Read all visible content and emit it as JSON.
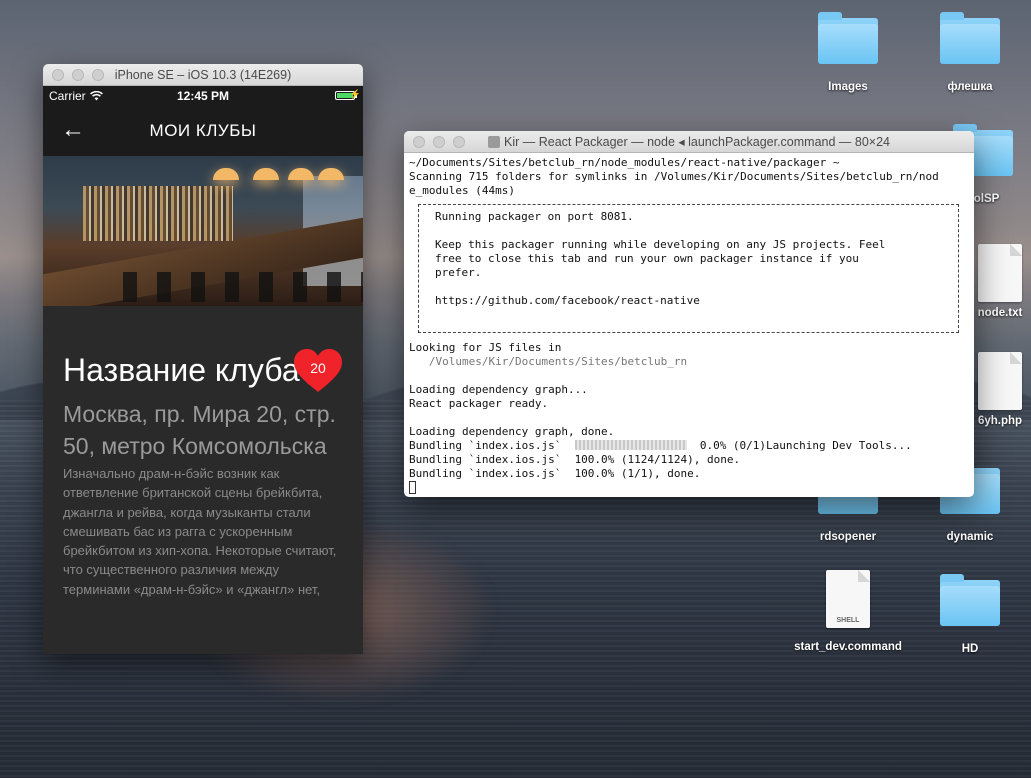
{
  "desktop": {
    "icons": [
      {
        "label": "Images",
        "kind": "folder"
      },
      {
        "label": "флешка",
        "kind": "folder"
      },
      {
        "label": "nolSP",
        "kind": "folder"
      },
      {
        "label": "node.txt",
        "kind": "file"
      },
      {
        "label": "6yh.php",
        "kind": "file"
      },
      {
        "label": "rdsopener",
        "kind": "folder"
      },
      {
        "label": "dynamic",
        "kind": "folder"
      },
      {
        "label": "start_dev.command",
        "kind": "shell",
        "badge": "SHELL"
      },
      {
        "label": "HD",
        "kind": "folder"
      }
    ]
  },
  "simulator": {
    "window_title": "iPhone SE – iOS 10.3 (14E269)",
    "status": {
      "carrier": "Carrier",
      "time": "12:45 PM"
    },
    "nav": {
      "back_icon": "←",
      "title": "МОИ КЛУБЫ"
    },
    "badge": {
      "count": "20",
      "color": "#f0232b"
    },
    "club": {
      "name": "Название клуба 1",
      "address": "Москва, пр. Мира 20, стр. 50, метро Комсомольска",
      "description": "Изначально драм-н-бэйс возник как ответвление британской сцены брейкбита, джангла и рейва, когда музыканты стали смешивать бас из рагга с ускоренным брейкбитом из хип-хопа. Некоторые считают, что существенного различия между терминами «драм-н-бэйс» и «джангл» нет,"
    }
  },
  "terminal": {
    "window_title": "Kir — React Packager — node ◂ launchPackager.command — 80×24",
    "lines_top": [
      "~/Documents/Sites/betclub_rn/node_modules/react-native/packager ~",
      "Scanning 715 folders for symlinks in /Volumes/Kir/Documents/Sites/betclub_rn/nod",
      "e_modules (44ms)"
    ],
    "box_lines": [
      "Running packager on port 8081.",
      "",
      "Keep this packager running while developing on any JS projects. Feel",
      "free to close this tab and run your own packager instance if you",
      "prefer.",
      "",
      "https://github.com/facebook/react-native",
      ""
    ],
    "looking": "Looking for JS files in",
    "looking_path": "   /Volumes/Kir/Documents/Sites/betclub_rn",
    "loading_graph": "Loading dependency graph...",
    "packager_ready": "React packager ready.",
    "graph_done": "Loading dependency graph, done.",
    "bundle_1_prefix": "Bundling `index.ios.js`  ",
    "bundle_1_suffix": "  0.0% (0/1)Launching Dev Tools...",
    "bundle_1_progress": 0.0,
    "bundle_2": "Bundling `index.ios.js`  100.0% (1124/1124), done.",
    "bundle_3": "Bundling `index.ios.js`  100.0% (1/1), done."
  }
}
